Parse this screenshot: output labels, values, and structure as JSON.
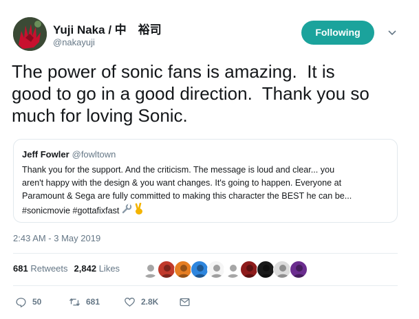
{
  "author": {
    "display_name": "Yuji Naka / 中　裕司",
    "handle": "@nakayuji"
  },
  "follow_button": {
    "label": "Following"
  },
  "tweet": {
    "lines": [
      "The power of sonic fans is amazing.  It is",
      "good to go in a good direction.  Thank you so",
      "much for loving Sonic."
    ]
  },
  "quoted_tweet": {
    "author_name": "Jeff Fowler",
    "author_handle": "@fowltown",
    "lines": [
      "Thank you for the support. And the criticism. The message is loud and clear... you",
      "aren't happy with the design & you want changes. It's going to happen. Everyone at",
      "Paramount & Sega are fully committed to making this character the BEST he can be...",
      "#sonicmovie #gottafixfast"
    ],
    "emoji": [
      "wrench-emoji",
      "victory-hand-emoji"
    ]
  },
  "timestamp": "2:43 AM - 3 May 2019",
  "stats": {
    "retweets_count": "681",
    "retweets_label": "Retweets",
    "likes_count": "2,842",
    "likes_label": "Likes"
  },
  "likers": [
    {
      "icon": "liker-avatar",
      "color": "#ffffff"
    },
    {
      "icon": "liker-avatar",
      "color": "#c0392b"
    },
    {
      "icon": "liker-avatar",
      "color": "#e67e22"
    },
    {
      "icon": "liker-avatar",
      "color": "#2e86de"
    },
    {
      "icon": "liker-avatar",
      "color": "#f5f5f5"
    },
    {
      "icon": "liker-avatar",
      "color": "#ffffff"
    },
    {
      "icon": "liker-avatar",
      "color": "#8e1b1b"
    },
    {
      "icon": "liker-avatar",
      "color": "#1a1a1a"
    },
    {
      "icon": "liker-avatar",
      "color": "#dcdcdc"
    },
    {
      "icon": "liker-avatar",
      "color": "#6b2d8f"
    }
  ],
  "actions": {
    "replies": "50",
    "retweets": "681",
    "likes": "2.8K"
  },
  "colors": {
    "follow_button_bg": "#1ba39c",
    "secondary_text": "#657786",
    "border": "#e1e8ed"
  }
}
